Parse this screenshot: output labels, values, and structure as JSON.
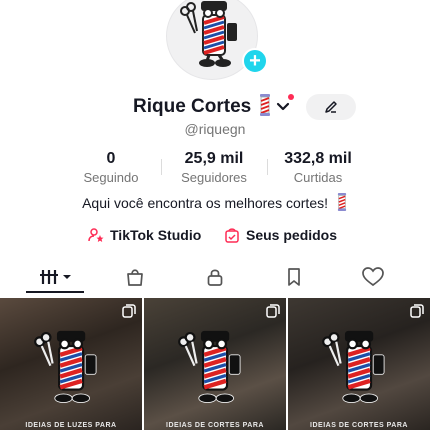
{
  "profile": {
    "name": "Rique Cortes",
    "handle": "@riquegn"
  },
  "stats": [
    {
      "value": "0",
      "label": "Seguindo"
    },
    {
      "value": "25,9 mil",
      "label": "Seguidores"
    },
    {
      "value": "332,8 mil",
      "label": "Curtidas"
    }
  ],
  "bio": "Aqui você encontra os melhores cortes!",
  "links": {
    "studio": "TikTok Studio",
    "orders": "Seus pedidos"
  },
  "posts": [
    {
      "caption": "IDEIAS DE LUZES PARA"
    },
    {
      "caption": "IDEIAS DE CORTES PARA"
    },
    {
      "caption": "IDEIAS DE CORTES PARA"
    }
  ],
  "colors": {
    "accent": "#fe2c55",
    "add": "#20d5ec",
    "text": "#161823",
    "muted": "#757575"
  }
}
